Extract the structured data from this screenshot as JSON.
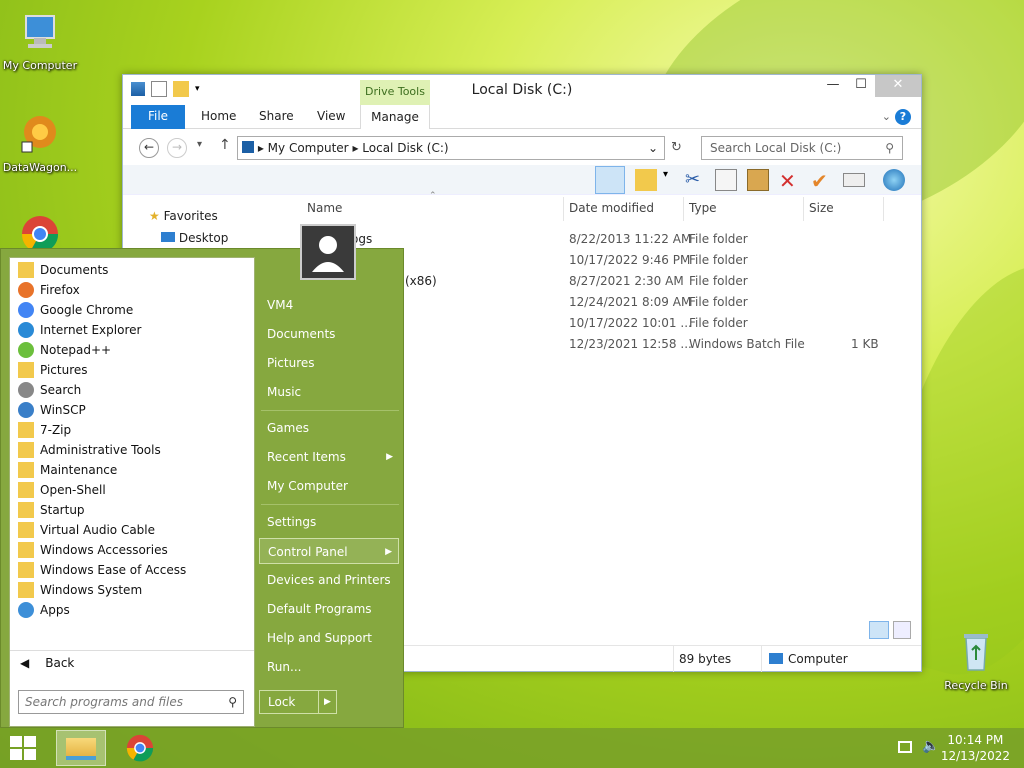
{
  "desktop": {
    "icons": [
      {
        "label": "My Computer"
      },
      {
        "label": "DataWagon..."
      },
      {
        "label": "Recycle Bin"
      }
    ]
  },
  "explorer": {
    "title": "Local Disk (C:)",
    "drive_tools": "Drive Tools",
    "tabs": {
      "file": "File",
      "home": "Home",
      "share": "Share",
      "view": "View",
      "manage": "Manage"
    },
    "breadcrumb": {
      "part1": "My Computer",
      "part2": "Local Disk (C:)"
    },
    "search_placeholder": "Search Local Disk (C:)",
    "nav": {
      "favorites": "Favorites",
      "desktop": "Desktop"
    },
    "columns": {
      "name": "Name",
      "date": "Date modified",
      "type": "Type",
      "size": "Size"
    },
    "files": [
      {
        "name": "ogs",
        "date": "8/22/2013 11:22 AM",
        "type": "File folder",
        "size": ""
      },
      {
        "name": "",
        "date": "10/17/2022 9:46 PM",
        "type": "File folder",
        "size": ""
      },
      {
        "name": "(x86)",
        "date": "8/27/2021 2:30 AM",
        "type": "File folder",
        "size": ""
      },
      {
        "name": "",
        "date": "12/24/2021 8:09 AM",
        "type": "File folder",
        "size": ""
      },
      {
        "name": "",
        "date": "10/17/2022 10:01 ...",
        "type": "File folder",
        "size": ""
      },
      {
        "name": "",
        "date": "12/23/2021 12:58 ...",
        "type": "Windows Batch File",
        "size": "1 KB"
      }
    ],
    "status": {
      "size": "89 bytes",
      "location": "Computer"
    }
  },
  "start_menu": {
    "programs": [
      {
        "label": "Documents",
        "icon": "folder-icon"
      },
      {
        "label": "Firefox",
        "icon": "firefox-icon"
      },
      {
        "label": "Google Chrome",
        "icon": "chrome-icon"
      },
      {
        "label": "Internet Explorer",
        "icon": "ie-icon"
      },
      {
        "label": "Notepad++",
        "icon": "notepad-icon"
      },
      {
        "label": "Pictures",
        "icon": "folder-icon"
      },
      {
        "label": "Search",
        "icon": "search-icon"
      },
      {
        "label": "WinSCP",
        "icon": "winscp-icon"
      },
      {
        "label": "7-Zip",
        "icon": "folder-icon"
      },
      {
        "label": "Administrative Tools",
        "icon": "folder-icon"
      },
      {
        "label": "Maintenance",
        "icon": "folder-icon"
      },
      {
        "label": "Open-Shell",
        "icon": "folder-icon"
      },
      {
        "label": "Startup",
        "icon": "folder-icon"
      },
      {
        "label": "Virtual Audio Cable",
        "icon": "folder-icon"
      },
      {
        "label": "Windows Accessories",
        "icon": "folder-icon"
      },
      {
        "label": "Windows Ease of Access",
        "icon": "folder-icon"
      },
      {
        "label": "Windows System",
        "icon": "folder-icon"
      },
      {
        "label": "Apps",
        "icon": "apps-icon"
      }
    ],
    "back": "Back",
    "search_placeholder": "Search programs and files",
    "right": {
      "vm4": "VM4",
      "documents": "Documents",
      "pictures": "Pictures",
      "music": "Music",
      "games": "Games",
      "recent": "Recent Items",
      "computer": "My Computer",
      "settings": "Settings",
      "control_panel": "Control Panel",
      "devices": "Devices and Printers",
      "defaults": "Default Programs",
      "help": "Help and Support",
      "run": "Run..."
    },
    "lock": "Lock"
  },
  "taskbar": {
    "time": "10:14 PM",
    "date": "12/13/2022"
  },
  "colors": {
    "accent": "#1a7cd6",
    "start_bg": "#86a83f"
  }
}
